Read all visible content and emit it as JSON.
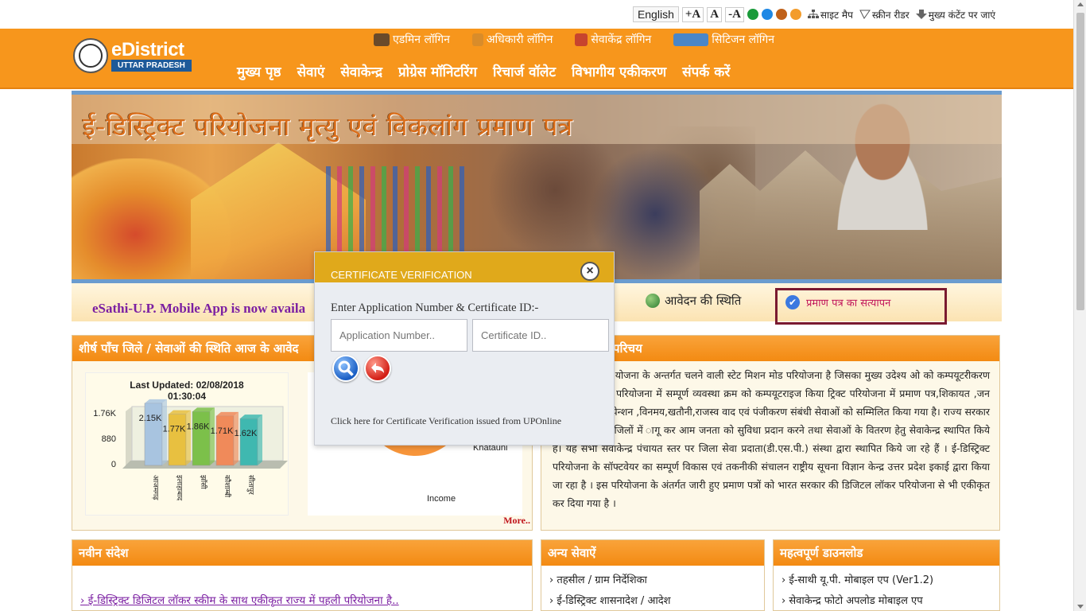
{
  "utility": {
    "language": "English",
    "font_plus": "+A",
    "font_normal": "A",
    "font_minus": "-A",
    "theme_colors": [
      "#1a9a3a",
      "#1e88e5",
      "#c0611a",
      "#f39c2b"
    ],
    "sitemap": "साइट मैप",
    "screen_reader": "स्क्रीन रीडर",
    "skip_content": "मुख्य कंटेंट पर जाएं"
  },
  "header": {
    "brand": "eDistrict",
    "brand_sub": "UTTAR PRADESH",
    "logins": [
      "एडमिन लॉगिन",
      "अधिकारी लॉगिन",
      "सेवाकेंद्र लॉगिन",
      "सिटिजन लॉगिन"
    ],
    "nav": [
      "मुख्य पृष्ठ",
      "सेवाएं",
      "सेवाकेन्द्र",
      "प्रोग्रेस मॉनिटरिंग",
      "रिचार्ज वॉलेट",
      "विभागीय एकीकरण",
      "संपर्क करें"
    ]
  },
  "banner": {
    "title": "ई-डिस्ट्रिक्ट परियोजना मृत्यु एवं विकलांग प्रमाण पत्र"
  },
  "strip": {
    "marquee": "eSathi-U.P. Mobile App is now availa",
    "status_link": "आवेदन की स्थिति",
    "verify_link": "प्रमाण पत्र का सत्यापन"
  },
  "top_five": {
    "heading": "शीर्ष पाँच जिले / सेवाओं की स्थिति आज के आवेद",
    "last_updated": "Last Updated: 02/08/2018",
    "last_updated_time": "01:30:04",
    "more": "More.."
  },
  "chart_data": [
    {
      "type": "bar",
      "title": "Last Updated: 02/08/2018 01:30:04",
      "categories": [
        "आजमगढ़",
        "इलाहाबाद",
        "झाँसी",
        "कौशाम्बी",
        "सीतापुर"
      ],
      "values": [
        2150,
        1770,
        1860,
        1710,
        1620
      ],
      "data_labels": [
        "2.15K",
        "1.77K",
        "1.86K",
        "1.71K",
        "1.62K"
      ],
      "ytick_labels": [
        "0",
        "880",
        "1.76K"
      ],
      "ylim": [
        0,
        2640
      ],
      "colors": [
        "#a8c4e0",
        "#e8c040",
        "#7cc04a",
        "#f08a5a",
        "#3fb8b0"
      ]
    },
    {
      "type": "pie",
      "labels": [
        "Income",
        "Khatauni"
      ],
      "colors": [
        "#f7953a",
        "#1f9a8a",
        "#7ec83a"
      ]
    }
  ],
  "intro": {
    "heading": "परिचय",
    "text": "ोजना ई-गवर्नेंस योजना के अन्तर्गत चलने वाली स्टेट मिशन मोड परियोजना है जिसका मुख्य उदेश्य ओ को कम्पयूटरीकरण करने का है। इस परियोजना में सम्पूर्ण व्यवस्था क्रम को कम्पयूटराइज किया ट्रिक्ट परियोजना में प्रमाण पत्र,शिकायत ,जन वितरण प्रणाली ,पेन्शन ,विनमय,खतौनी,राजस्व वाद एवं पंजीकरण संबंधी सेवाओं को सम्मिलित किया गया है। राज्य सरकार ने प्रदेश के सभी जिलों में ागू कर आम जनता को सुविधा प्रदान करने तथा सेवाओं के वितरण हेतु सेवाकेन्द्र स्थापित किये है। यह सभी सेवाकेन्द्र पंचायत स्तर पर जिला सेवा प्रदाता(डी.एस.पी.) संस्था द्वारा स्थापित किये जा रहे हैं । ई-डिस्ट्रिक्ट परियोजना के सॉफ्टवेयर का सम्पूर्ण विकास एवं तकनीकी संचालन राष्ट्रीय सूचना विज्ञान केन्द्र उत्तर प्रदेश इकाई द्वारा किया जा रहा है । इस परियोजना के अंतर्गत जारी हुए प्रमाण पत्रों को भारत सरकार की डिजिटल लॉकर परियोजना से भी एकीकृत कर दिया गया है ।"
  },
  "news": {
    "heading": "नवीन संदेश",
    "item": "ई-डिस्ट्रिक्ट डिजिटल लॉकर स्कीम के साथ एकीकृत राज्य में पहली परियोजना है.."
  },
  "other_services": {
    "heading": "अन्य सेवाऐं",
    "items": [
      "तहसील / ग्राम निर्देशिका",
      "ई-डिस्ट्रिक्ट शासनादेश / आदेश"
    ]
  },
  "downloads": {
    "heading": "महत्वपूर्ण डाउनलोड",
    "items": [
      "ई-साथी यू.पी. मोबाइल एप (Ver1.2)",
      "सेवाकेन्द्र फोटो अपलोड मोबाइल एप"
    ]
  },
  "modal": {
    "title": "CERTIFICATE VERIFICATION",
    "label": "Enter Application Number & Certificate ID:-",
    "app_placeholder": "Application Number..",
    "cert_placeholder": "Certificate ID..",
    "footer": "Click here for Certificate Verification issued from UPOnline"
  }
}
